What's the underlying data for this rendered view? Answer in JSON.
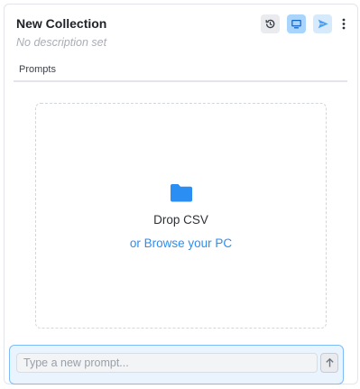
{
  "collection": {
    "title": "New Collection",
    "description_placeholder": "No description set"
  },
  "header_actions": [
    {
      "icon": "history-icon"
    },
    {
      "icon": "monitor-icon"
    },
    {
      "icon": "send-icon"
    },
    {
      "icon": "more-vertical-icon"
    }
  ],
  "tabs": [
    {
      "label": "Prompts"
    }
  ],
  "dropzone": {
    "icon": "folder-icon",
    "title": "Drop CSV",
    "browse_label": "or Browse your PC"
  },
  "composer": {
    "placeholder": "Type a new prompt...",
    "send_icon": "arrow-up-icon"
  },
  "colors": {
    "accent": "#2e8ef0",
    "folder": "#2b8ef3",
    "composer_border": "#7dbcf8"
  }
}
